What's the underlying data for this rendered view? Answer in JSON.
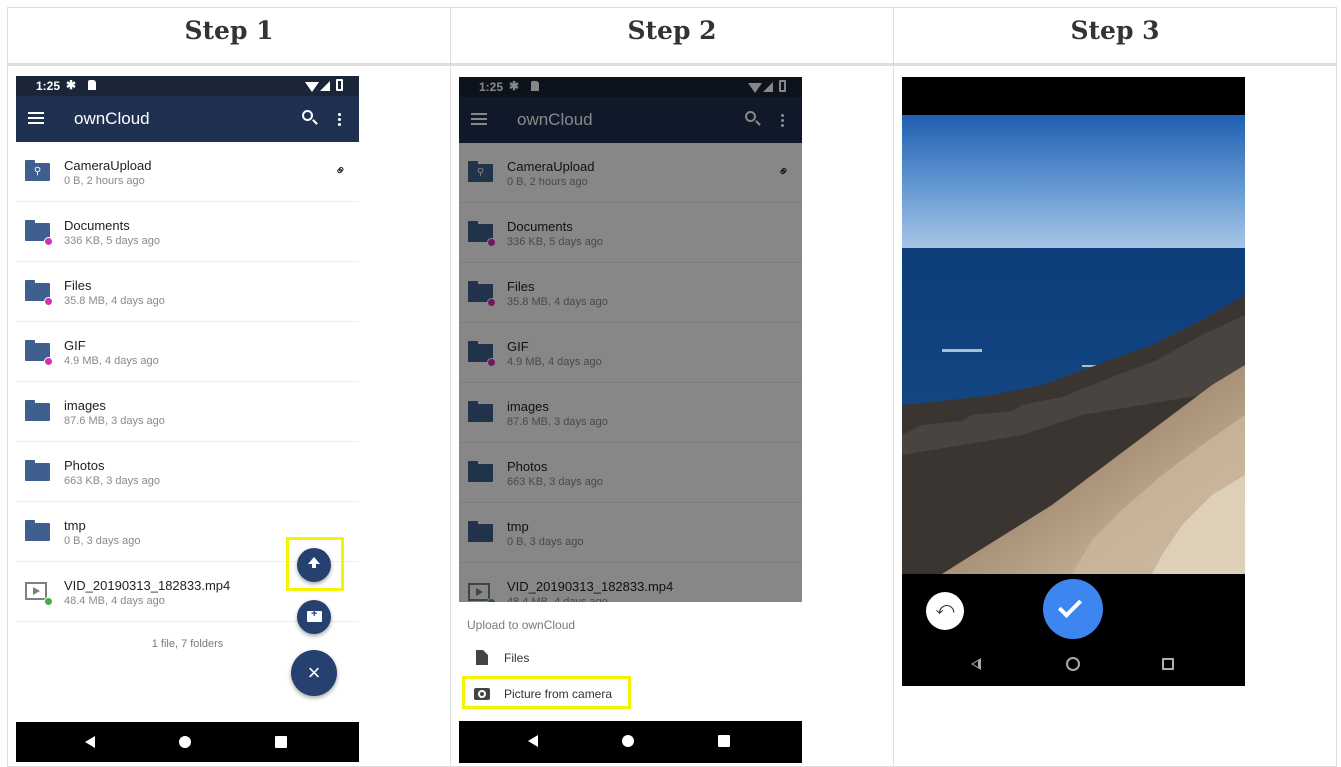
{
  "steps": [
    {
      "title": "Step 1"
    },
    {
      "title": "Step 2"
    },
    {
      "title": "Step 3"
    }
  ],
  "status": {
    "time": "1:25"
  },
  "app": {
    "title": "ownCloud"
  },
  "files": [
    {
      "name": "CameraUpload",
      "meta": "0 B, 2 hours ago",
      "icon": "link-folder-icon",
      "badge": "none",
      "shared_link": true
    },
    {
      "name": "Documents",
      "meta": "336 KB, 5 days ago",
      "icon": "folder-icon",
      "badge": "shared"
    },
    {
      "name": "Files",
      "meta": "35.8 MB, 4 days ago",
      "icon": "folder-icon",
      "badge": "shared"
    },
    {
      "name": "GIF",
      "meta": "4.9 MB, 4 days ago",
      "icon": "folder-icon",
      "badge": "shared"
    },
    {
      "name": "images",
      "meta": "87.6 MB, 3 days ago",
      "icon": "folder-icon",
      "badge": "none"
    },
    {
      "name": "Photos",
      "meta": "663 KB, 3 days ago",
      "icon": "folder-icon",
      "badge": "none"
    },
    {
      "name": "tmp",
      "meta": "0 B, 3 days ago",
      "icon": "folder-icon",
      "badge": "none"
    },
    {
      "name": "VID_20190313_182833.mp4",
      "meta": "48.4 MB, 4 days ago",
      "icon": "video-file-icon",
      "badge": "downloaded"
    }
  ],
  "footer": {
    "count": "1 file, 7 folders"
  },
  "fab": {
    "close_symbol": "×"
  },
  "upload_sheet": {
    "title": "Upload to ownCloud",
    "items": [
      {
        "label": "Files",
        "icon": "document-icon"
      },
      {
        "label": "Picture from camera",
        "icon": "camera-icon"
      }
    ]
  },
  "colors": {
    "statusbar": "#1a2537",
    "appbar": "#1f3050",
    "folder": "#3f5f8e",
    "share_badge": "#d22fb4",
    "fab": "#264170",
    "highlight": "#f4f400",
    "confirm": "#3d86f0"
  }
}
